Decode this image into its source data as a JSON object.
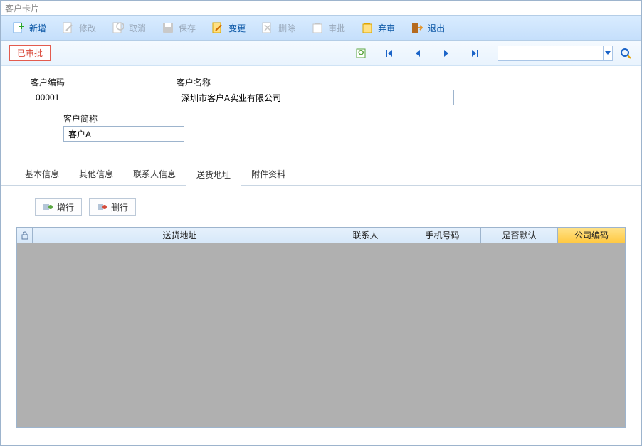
{
  "window": {
    "title": "客户卡片"
  },
  "toolbar": {
    "add": "新增",
    "edit": "修改",
    "cancel": "取消",
    "save": "保存",
    "change": "变更",
    "delete": "删除",
    "approve": "审批",
    "reject": "弃审",
    "exit": "退出"
  },
  "status": {
    "label": "已审批"
  },
  "search": {
    "value": ""
  },
  "form": {
    "code_label": "客户编码",
    "code_value": "00001",
    "name_label": "客户名称",
    "name_value": "深圳市客户A实业有限公司",
    "short_label": "客户简称",
    "short_value": "客户A"
  },
  "tabs": {
    "basic": "基本信息",
    "other": "其他信息",
    "contacts": "联系人信息",
    "shipping": "送货地址",
    "attachments": "附件资料"
  },
  "row_buttons": {
    "add": "增行",
    "del": "删行"
  },
  "grid": {
    "columns": {
      "addr": "送货地址",
      "contact": "联系人",
      "phone": "手机号码",
      "is_default": "是否默认",
      "company_code": "公司编码"
    },
    "rows": []
  }
}
